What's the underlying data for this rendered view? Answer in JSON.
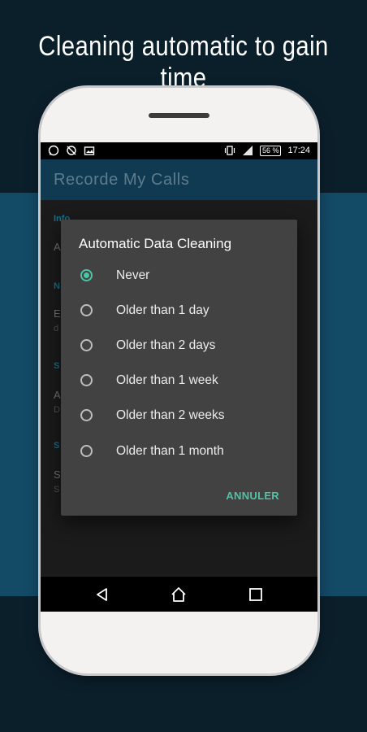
{
  "headline": "Cleaning automatic to gain time",
  "status_bar": {
    "battery": "56 %",
    "time": "17:24",
    "left_icons": [
      "whatsapp-icon",
      "sync-off-icon",
      "photo-icon"
    ],
    "right_icons": [
      "vibrate-icon",
      "signal-icon"
    ]
  },
  "app": {
    "title": "Recorde My Calls"
  },
  "background_settings": {
    "sections": [
      {
        "header": "Info",
        "item": "A",
        "sub": ""
      },
      {
        "header": "N",
        "item": "E",
        "sub": "d"
      },
      {
        "header": "S",
        "item": "A",
        "sub": "D"
      },
      {
        "header": "S",
        "item": "S",
        "sub": "S"
      }
    ]
  },
  "dialog": {
    "title": "Automatic Data Cleaning",
    "options": [
      {
        "label": "Never",
        "selected": true
      },
      {
        "label": "Older than 1 day",
        "selected": false
      },
      {
        "label": "Older than 2 days",
        "selected": false
      },
      {
        "label": "Older than 1 week",
        "selected": false
      },
      {
        "label": "Older than 2 weeks",
        "selected": false
      },
      {
        "label": "Older than 1 month",
        "selected": false
      }
    ],
    "cancel_label": "ANNULER"
  },
  "nav": [
    "back-icon",
    "home-icon",
    "recents-icon"
  ],
  "colors": {
    "accent": "#4fc3a5",
    "appbar": "#0f3a52",
    "band": "#134a66",
    "background": "#0b1f2b"
  }
}
